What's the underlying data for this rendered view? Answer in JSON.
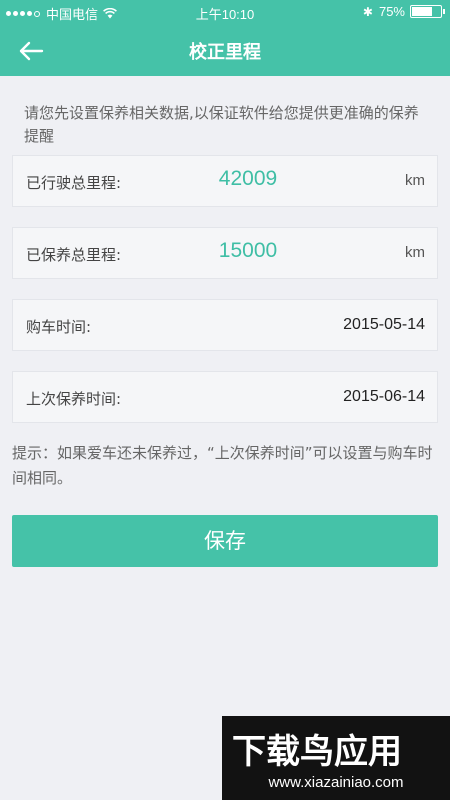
{
  "status_bar": {
    "carrier": "中国电信",
    "time": "上午10:10",
    "battery_percent": "75%",
    "battery_level": 0.75,
    "bluetooth_icon": "bluetooth-icon",
    "wifi_icon": "wifi-icon",
    "signal_strength": 4
  },
  "header": {
    "title": "校正里程",
    "back_icon": "arrow-left-icon"
  },
  "intro_text": "请您先设置保养相关数据,以保证软件给您提供更准确的保养提醒",
  "fields": {
    "total_mileage": {
      "label": "已行驶总里程:",
      "value": "42009",
      "unit": "km"
    },
    "maintained_mileage": {
      "label": "已保养总里程:",
      "value": "15000",
      "unit": "km"
    },
    "purchase_date": {
      "label": "购车时间:",
      "value": "2015-05-14"
    },
    "last_maintenance_date": {
      "label": "上次保养时间:",
      "value": "2015-06-14"
    }
  },
  "hint_text": "提示：如果爱车还未保养过，“上次保养时间”可以设置与购车时间相同。",
  "save_label": "保存",
  "watermark": {
    "logo_text": "下载鸟应用",
    "url": "www.xiazainiao.com"
  },
  "colors": {
    "accent": "#45c2a8",
    "value_text": "#3fbea5",
    "background": "#eff0f4"
  }
}
